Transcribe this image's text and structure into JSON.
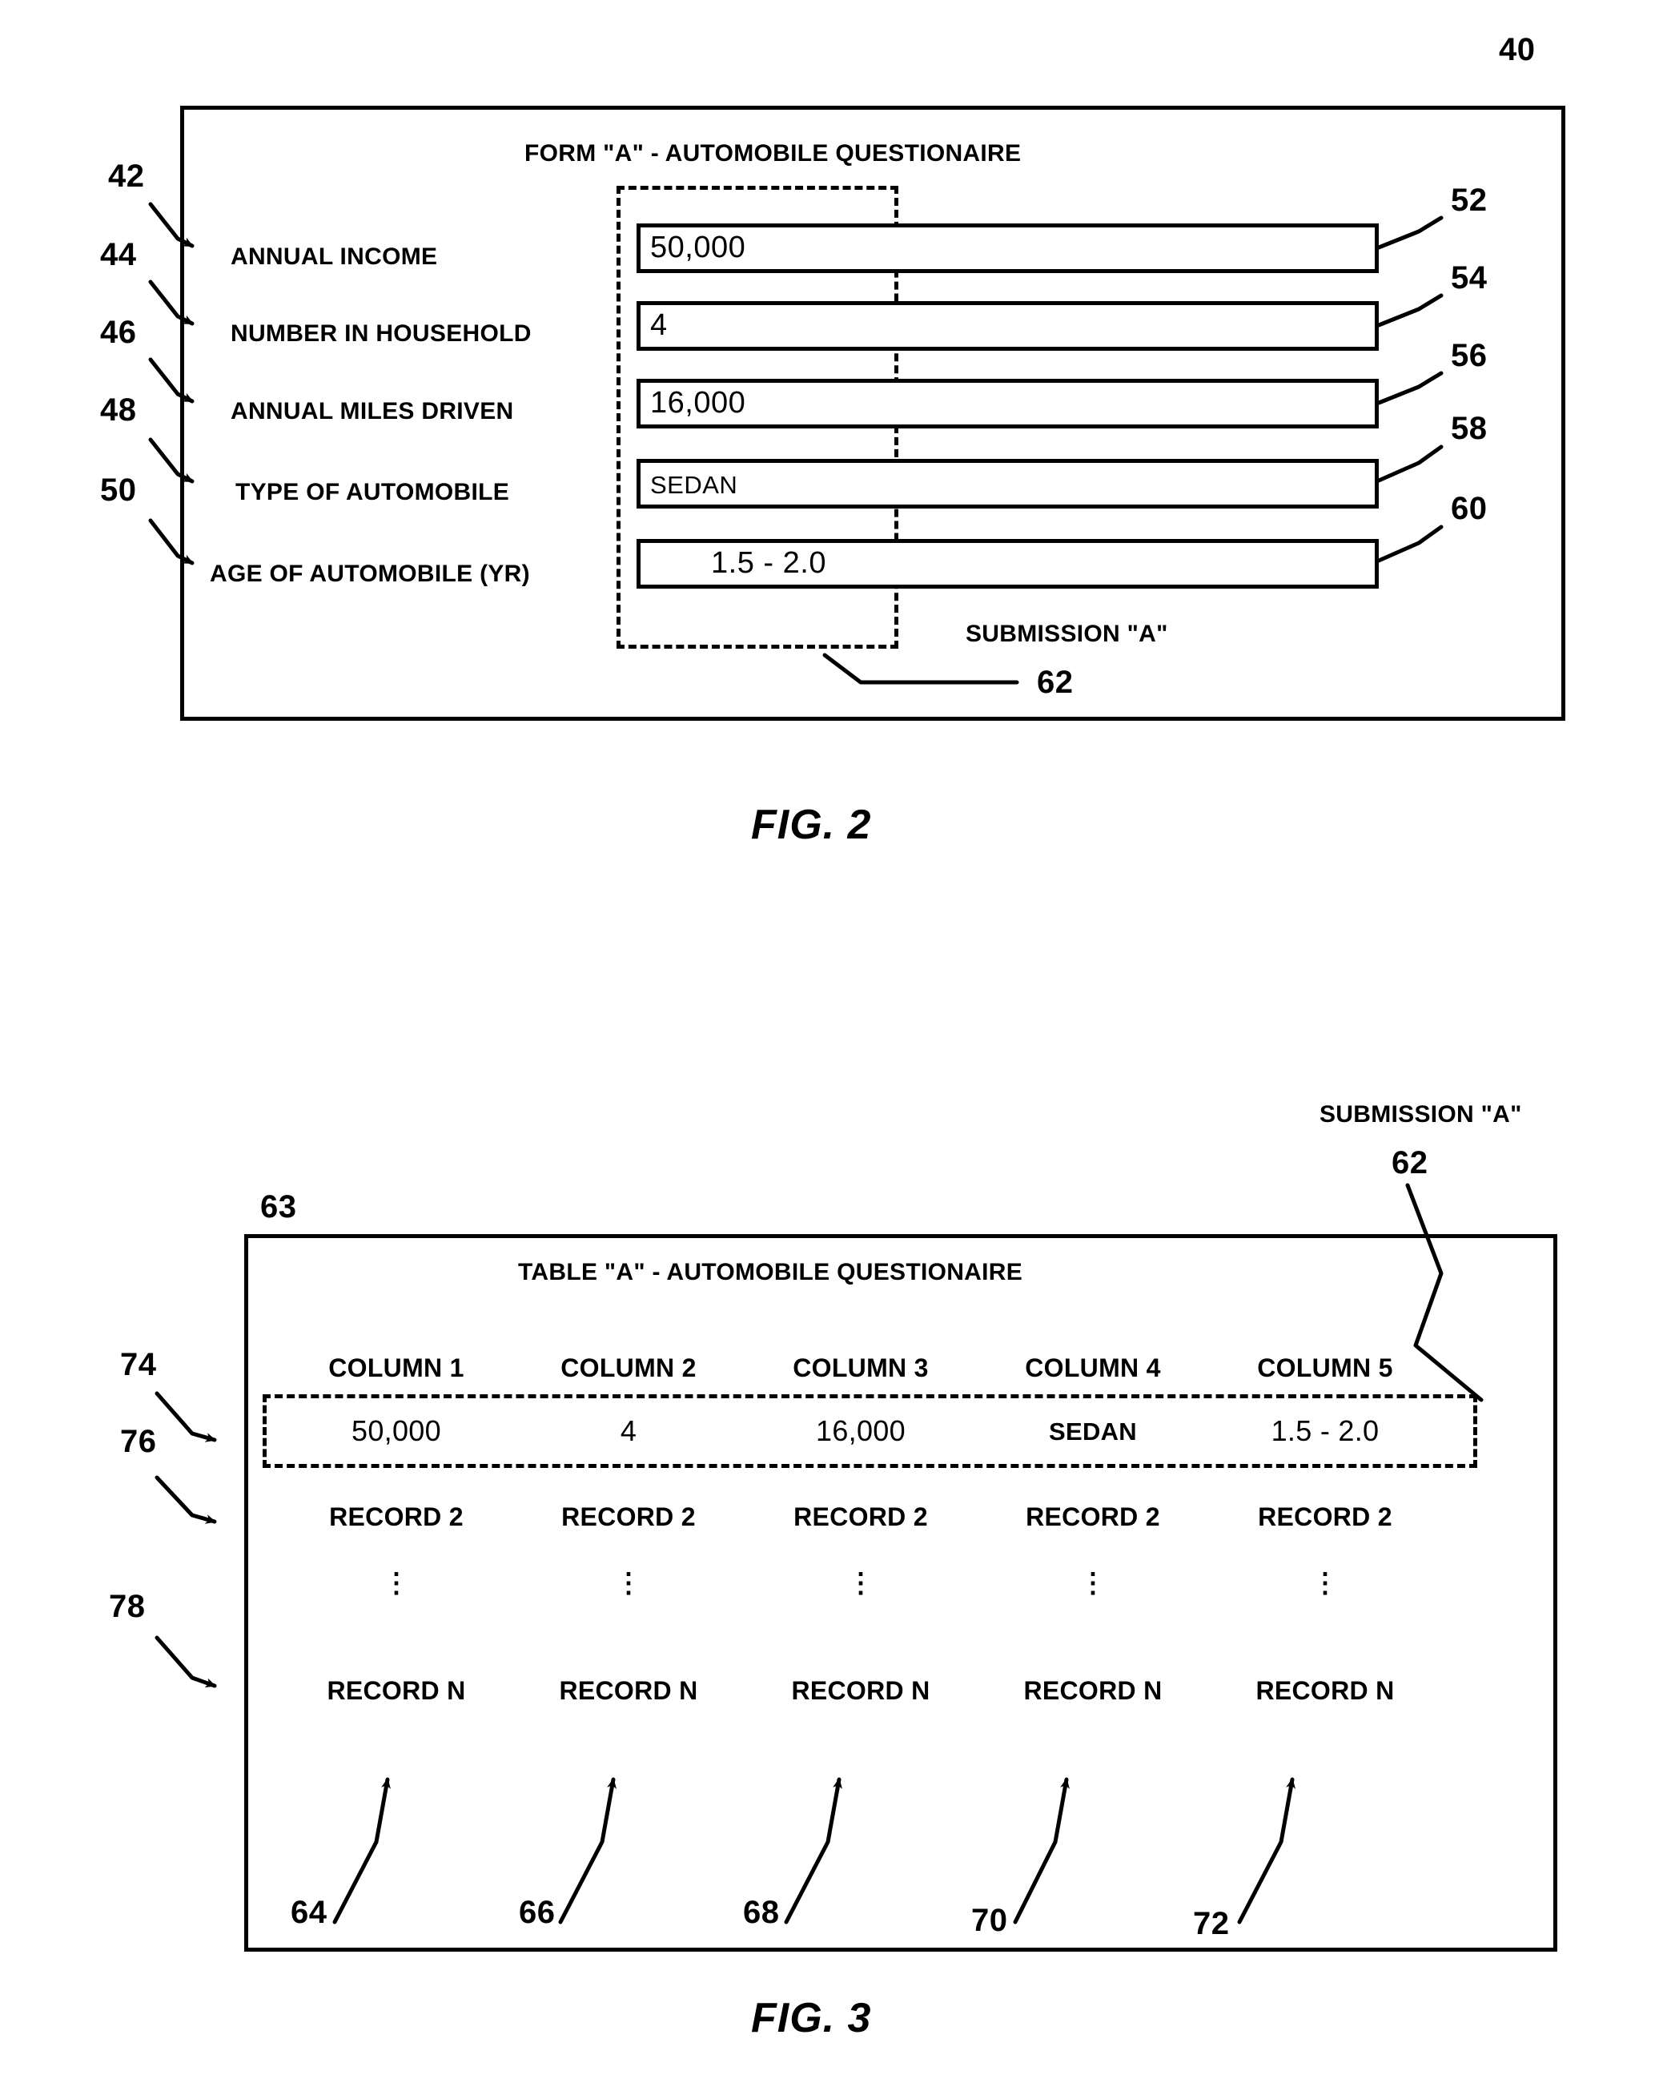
{
  "figures": [
    {
      "id": "fig2",
      "caption": "FIG. 2",
      "box_ref": "40",
      "title": "FORM \"A\" - AUTOMOBILE QUESTIONAIRE",
      "group_ref": "42",
      "submission_label": "SUBMISSION \"A\"",
      "submission_ref": "62",
      "rows": [
        {
          "label": "ANNUAL INCOME",
          "value": "50,000",
          "label_ref": "44",
          "field_ref": "52",
          "align": "left"
        },
        {
          "label": "NUMBER IN HOUSEHOLD",
          "value": "4",
          "label_ref": "46",
          "field_ref": "54",
          "align": "left"
        },
        {
          "label": "ANNUAL MILES DRIVEN",
          "value": "16,000",
          "label_ref": "48",
          "field_ref": "56",
          "align": "left"
        },
        {
          "label": "TYPE OF AUTOMOBILE",
          "value": "SEDAN",
          "label_ref": "50",
          "field_ref": "58",
          "align": "left"
        },
        {
          "label": "AGE OF AUTOMOBILE (YR)",
          "value": "1.5 - 2.0",
          "label_ref": "",
          "field_ref": "60",
          "align": "center"
        }
      ]
    },
    {
      "id": "fig3",
      "caption": "FIG. 3",
      "box_ref": "63",
      "title": "TABLE \"A\" - AUTOMOBILE QUESTIONAIRE",
      "submission_label": "SUBMISSION \"A\"",
      "submission_ref": "62",
      "header_ref": "74",
      "record1_ref": "76",
      "record2_ref": "",
      "recordn_ref": "78",
      "columns": [
        "COLUMN 1",
        "COLUMN 2",
        "COLUMN 3",
        "COLUMN 4",
        "COLUMN 5"
      ],
      "column_refs": [
        "64",
        "66",
        "68",
        "70",
        "72"
      ],
      "rows": [
        {
          "kind": "record1",
          "cells": [
            "50,000",
            "4",
            "16,000",
            "SEDAN",
            "1.5 - 2.0"
          ]
        },
        {
          "kind": "record2",
          "cells": [
            "RECORD 2",
            "RECORD 2",
            "RECORD 2",
            "RECORD 2",
            "RECORD 2"
          ]
        },
        {
          "kind": "ellipsis",
          "cells": [
            "⋮",
            "⋮",
            "⋮",
            "⋮",
            "⋮"
          ]
        },
        {
          "kind": "recordn",
          "cells": [
            "RECORD N",
            "RECORD N",
            "RECORD N",
            "RECORD N",
            "RECORD N"
          ]
        }
      ]
    }
  ],
  "colors": {
    "ink": "#000000",
    "paper": "#ffffff"
  }
}
